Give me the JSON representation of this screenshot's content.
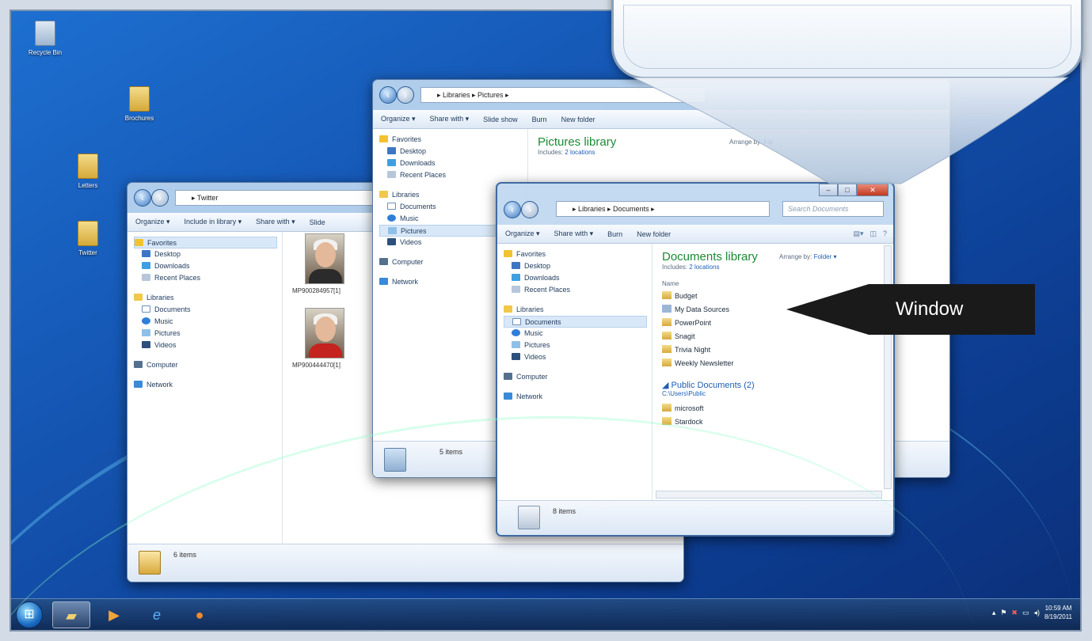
{
  "desktop": {
    "icons": [
      {
        "label": "Recycle Bin"
      },
      {
        "label": "Brochures"
      },
      {
        "label": "Letters"
      },
      {
        "label": "Twitter"
      }
    ]
  },
  "twitter_window": {
    "address": "▸ Twitter",
    "toolbar": [
      "Organize ▾",
      "Include in library ▾",
      "Share with ▾",
      "Slide"
    ],
    "nav": {
      "favorites": "Favorites",
      "desktop": "Desktop",
      "downloads": "Downloads",
      "recent": "Recent Places",
      "libraries": "Libraries",
      "documents": "Documents",
      "music": "Music",
      "pictures": "Pictures",
      "videos": "Videos",
      "computer": "Computer",
      "network": "Network"
    },
    "files": [
      "MP900284957[1]",
      "MP900444470[1]"
    ],
    "status": "6 items"
  },
  "pictures_window": {
    "address": "▸ Libraries ▸ Pictures ▸",
    "toolbar": [
      "Organize ▾",
      "Share with ▾",
      "Slide show",
      "Burn",
      "New folder"
    ],
    "nav": {
      "favorites": "Favorites",
      "desktop": "Desktop",
      "downloads": "Downloads",
      "recent": "Recent Places",
      "libraries": "Libraries",
      "documents": "Documents",
      "music": "Music",
      "pictures": "Pictures",
      "videos": "Videos",
      "computer": "Computer",
      "network": "Network"
    },
    "title": "Pictures library",
    "includes": "Includes:",
    "locations": "2 locations",
    "arrange_label": "Arrange by:",
    "arrange_value": "Fol",
    "status": "5 items"
  },
  "documents_window": {
    "address": "▸ Libraries ▸ Documents ▸",
    "search_placeholder": "Search Documents",
    "toolbar": [
      "Organize ▾",
      "Share with ▾",
      "Burn",
      "New folder"
    ],
    "nav": {
      "favorites": "Favorites",
      "desktop": "Desktop",
      "downloads": "Downloads",
      "recent": "Recent Places",
      "libraries": "Libraries",
      "documents": "Documents",
      "music": "Music",
      "pictures": "Pictures",
      "videos": "Videos",
      "computer": "Computer",
      "network": "Network"
    },
    "title": "Documents library",
    "includes": "Includes:",
    "locations": "2 locations",
    "arrange_label": "Arrange by:",
    "arrange_value": "Folder ▾",
    "column_name": "Name",
    "files": [
      "Budget",
      "My Data Sources",
      "PowerPoint",
      "Snagit",
      "Trivia Night",
      "Weekly Newsletter"
    ],
    "public_group": "Public Documents (2)",
    "public_path": "C:\\Users\\Public",
    "public_files": [
      "microsoft",
      "Stardock"
    ],
    "status": "8 items"
  },
  "taskbar": {
    "start_icon": "windows-orb-icon",
    "buttons": [
      {
        "icon": "explorer-icon",
        "active": true
      },
      {
        "icon": "media-player-icon",
        "active": false
      },
      {
        "icon": "internet-explorer-icon",
        "active": false
      },
      {
        "icon": "firefox-icon",
        "active": false
      }
    ],
    "clock_time": "10:59 AM",
    "clock_date": "8/19/2011"
  },
  "callout": {
    "label": "Window",
    "color": "#1a1a1a"
  },
  "colors": {
    "library_title": "#1c8a35",
    "link": "#1f5fb3",
    "desktop": "#1556b3"
  }
}
